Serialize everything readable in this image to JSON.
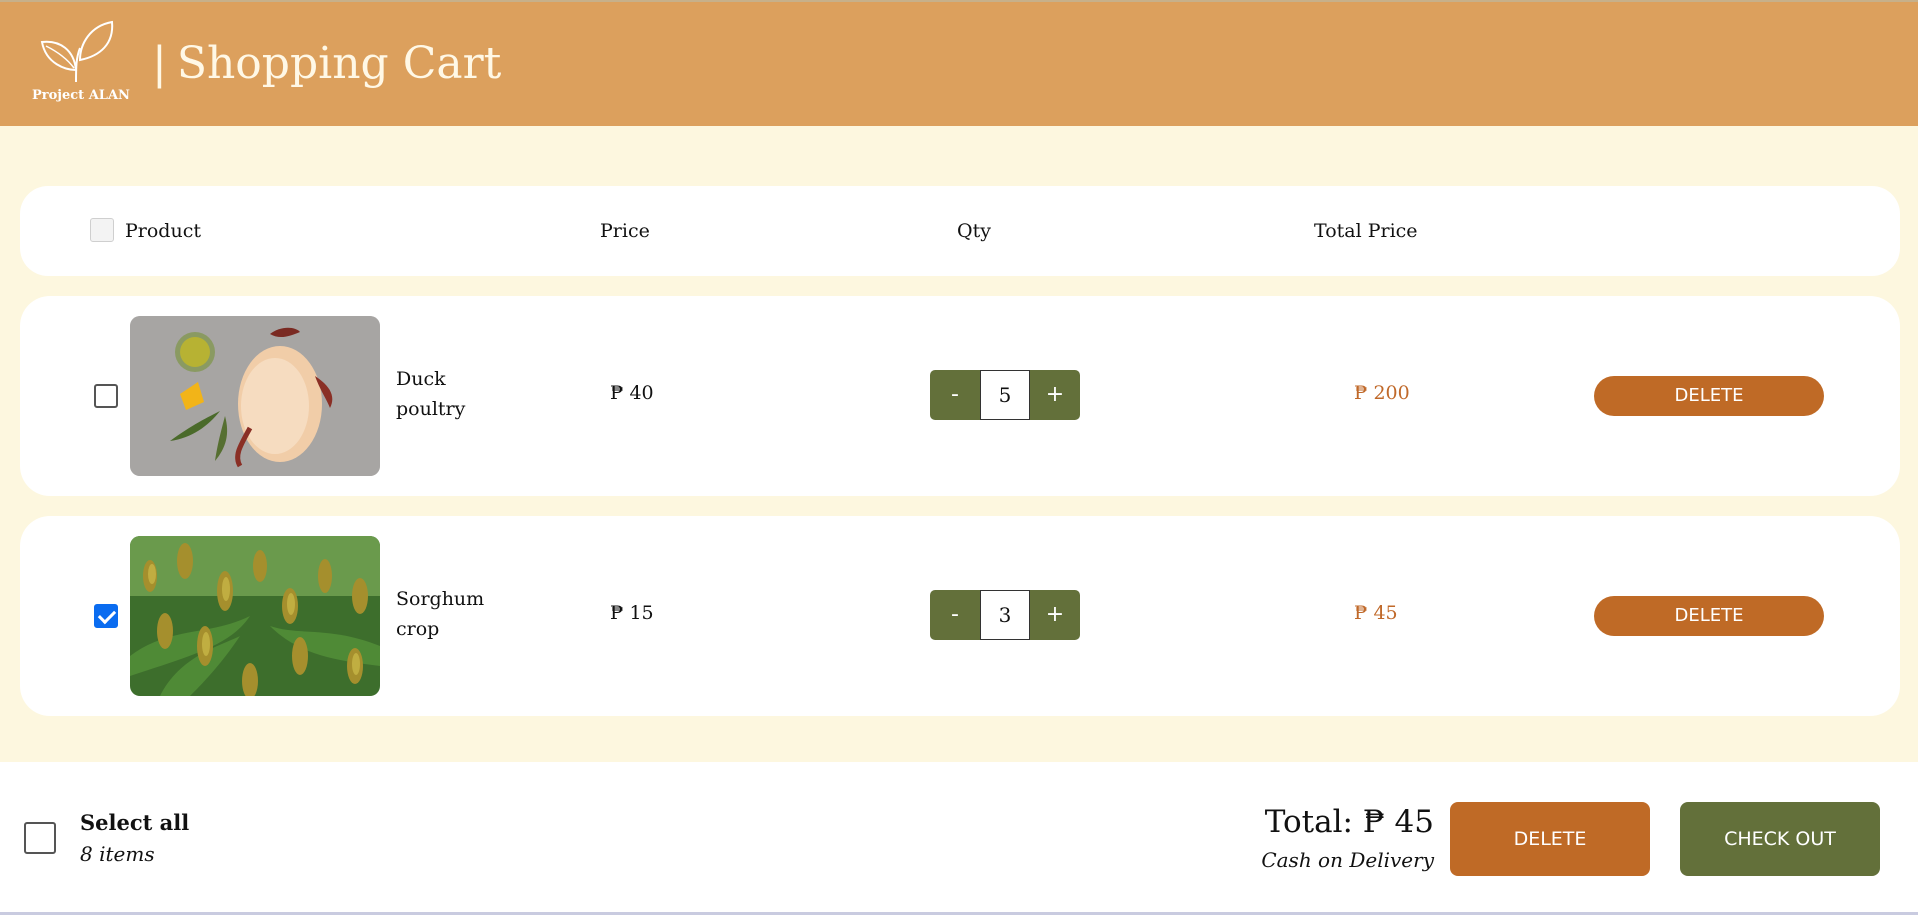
{
  "header": {
    "logo_text": "Project ALAN",
    "title": "Shopping Cart",
    "bg_color": "#dca05d"
  },
  "columns": {
    "product": "Product",
    "price": "Price",
    "qty": "Qty",
    "total_price": "Total Price"
  },
  "items": [
    {
      "name": "Duck poultry",
      "price": "₱ 40",
      "qty": "5",
      "total": "₱ 200",
      "checked": false,
      "delete_label": "DELETE",
      "minus_label": "-",
      "plus_label": "+"
    },
    {
      "name": "Sorghum crop",
      "price": "₱ 15",
      "qty": "3",
      "total": "₱ 45",
      "checked": true,
      "delete_label": "DELETE",
      "minus_label": "-",
      "plus_label": "+"
    }
  ],
  "footer": {
    "select_all_label": "Select all",
    "items_count": "8 items",
    "total_label": "Total: ₱ 45",
    "payment_method": "Cash on Delivery",
    "delete_label": "DELETE",
    "checkout_label": "CHECK OUT"
  },
  "colors": {
    "page_bg": "#fdf7df",
    "accent_orange": "#bf6a26",
    "accent_olive": "#63703a",
    "checkbox_checked": "#0a6cf0"
  }
}
